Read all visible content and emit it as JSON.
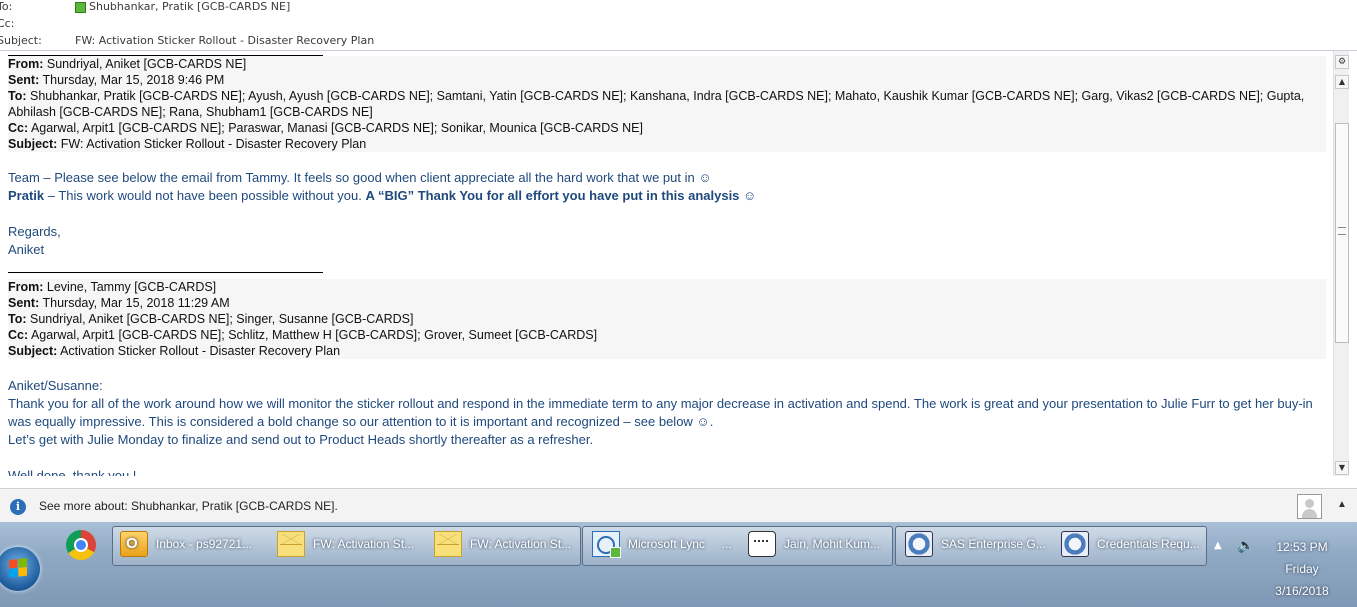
{
  "header": {
    "to_label": "To:",
    "to_value": "Shubhankar, Pratik [GCB-CARDS NE]",
    "cc_label": "Cc:",
    "cc_value": "",
    "subject_label": "Subject:",
    "subject_value": "FW: Activation Sticker Rollout - Disaster Recovery Plan"
  },
  "email1": {
    "from_label": "From:",
    "from": " Sundriyal, Aniket [GCB-CARDS NE]",
    "sent_label": "Sent:",
    "sent": " Thursday, Mar 15, 2018 9:46 PM",
    "to_label": "To:",
    "to": " Shubhankar, Pratik [GCB-CARDS NE]; Ayush, Ayush [GCB-CARDS NE]; Samtani, Yatin [GCB-CARDS NE]; Kanshana, Indra [GCB-CARDS NE]; Mahato, Kaushik Kumar [GCB-CARDS NE]; Garg, Vikas2 [GCB-CARDS NE]; Gupta, Abhilash [GCB-CARDS NE]; Rana, Shubham1 [GCB-CARDS NE]",
    "cc_label": "Cc:",
    "cc": " Agarwal, Arpit1 [GCB-CARDS NE]; Paraswar, Manasi [GCB-CARDS NE]; Sonikar, Mounica [GCB-CARDS NE]",
    "subject_label": "Subject:",
    "subject": " FW: Activation Sticker Rollout - Disaster Recovery Plan",
    "line1": "Team – Please see below the email from Tammy. It feels so good when client appreciate all the hard work that we put in ☺",
    "line2_name": "Pratik",
    "line2_text": " – This work would not have been possible without you. ",
    "line2_bold": "A “BIG” Thank You for all effort you have put in this analysis ☺",
    "regards": "Regards,",
    "signature": "Aniket"
  },
  "email2": {
    "from_label": "From:",
    "from": " Levine, Tammy [GCB-CARDS]",
    "sent_label": "Sent:",
    "sent": " Thursday, Mar 15, 2018 11:29 AM",
    "to_label": "To:",
    "to": " Sundriyal, Aniket [GCB-CARDS NE]; Singer, Susanne [GCB-CARDS]",
    "cc_label": "Cc:",
    "cc": " Agarwal, Arpit1 [GCB-CARDS NE]; Schlitz, Matthew H [GCB-CARDS]; Grover, Sumeet [GCB-CARDS]",
    "subject_label": "Subject:",
    "subject": " Activation Sticker Rollout - Disaster Recovery Plan",
    "greeting": "Aniket/Susanne:",
    "para1": "Thank you for all of the work around how we will monitor the sticker rollout and respond in the immediate term to any major decrease in activation and spend.   The work is great and your presentation to Julie Furr to get her buy-in was equally impressive.   This is considered a bold change so our attention to it is important and recognized – see below ☺.",
    "para2": "Let’s get with Julie Monday to finalize and send out to Product Heads shortly thereafter as a refresher.",
    "closing": "Well done, thank you !"
  },
  "infobar": {
    "text": "See more about: Shubhankar, Pratik [GCB-CARDS NE]."
  },
  "taskbar": {
    "items": [
      {
        "label": "Inbox - ps92721...",
        "icon": "outlook-icon"
      },
      {
        "label": "FW: Activation St...",
        "icon": "mail-envelope-icon"
      },
      {
        "label": "FW: Activation St...",
        "icon": "mail-envelope-icon"
      },
      {
        "label": "Microsoft Lync",
        "icon": "lync-icon"
      },
      {
        "label": "Jain, Mohit Kum...",
        "icon": "chat-bubble-icon"
      },
      {
        "label": "SAS Enterprise G...",
        "icon": "sas-icon"
      },
      {
        "label": "Credentials Requ...",
        "icon": "sas-icon"
      }
    ],
    "lync_dots": "...",
    "clock_time": "12:53 PM",
    "clock_day": "Friday",
    "clock_date": "3/16/2018"
  }
}
